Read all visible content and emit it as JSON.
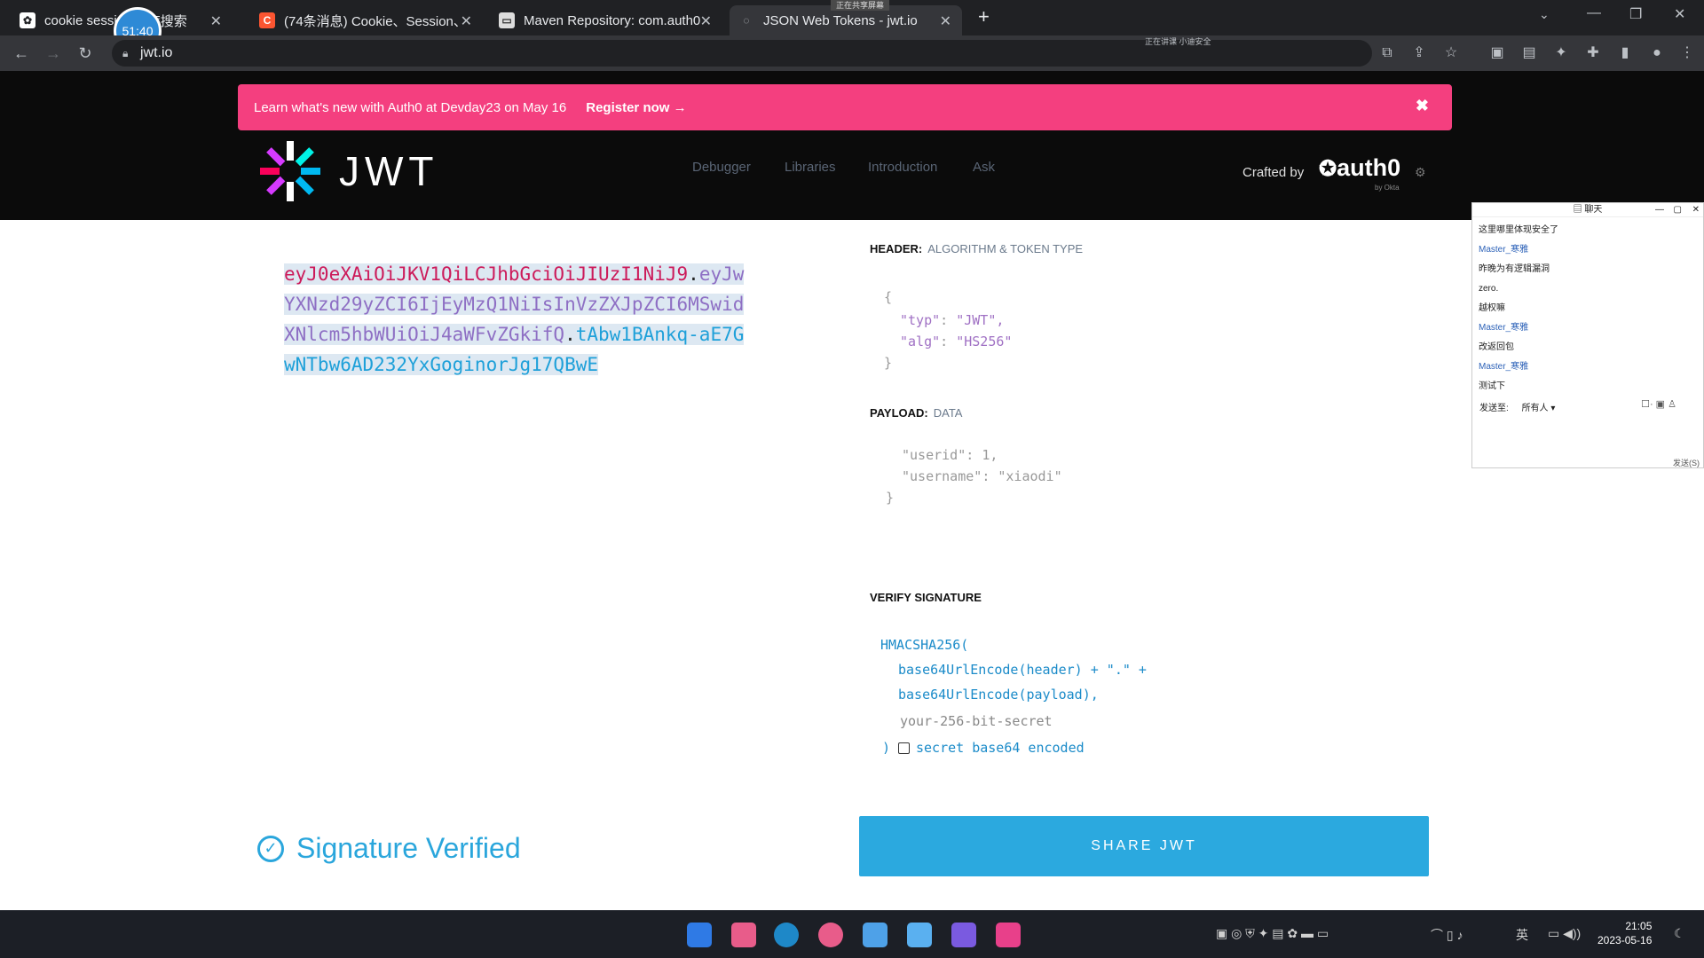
{
  "browser": {
    "tabs": [
      {
        "title": "cookie sessi",
        "extra": "度搜索"
      },
      {
        "title": "(74条消息) Cookie、Session、"
      },
      {
        "title": "Maven Repository: com.auth0"
      },
      {
        "title": "JSON Web Tokens - jwt.io"
      }
    ],
    "tab_badge": "正在共享屏幕",
    "url": "jwt.io",
    "share_status": "正在讲课 小迪安全"
  },
  "recording_timer": "51:40",
  "banner": {
    "text": "Learn what's new with Auth0 at Devday23 on May 16",
    "link": "Register now →",
    "close": "✖"
  },
  "site": {
    "logo_text": "JWT",
    "nav": [
      "Debugger",
      "Libraries",
      "Introduction",
      "Ask"
    ],
    "crafted_by": "Crafted by",
    "auth0": "auth0",
    "auth0_sub": "by Okta"
  },
  "encoded": {
    "header_part": "eyJ0eXAiOiJKV1QiLCJhbGciOiJIUzI1NiJ9",
    "payload_part": "eyJwYXNzd29yZCI6IjEyMzQ1NiIsInVzZXJpZCI6MSwidXNlcm5hbWUiOiJ4aWFvZGkifQ",
    "signature_part": "tAbw1BAnkq-aE7GwNTbw6AD232YxGoginorJg17QBwE"
  },
  "decoded": {
    "header_title": "HEADER:",
    "header_sub": "ALGORITHM & TOKEN TYPE",
    "header_lines": [
      {
        "key": "\"typ\"",
        "value": "\"JWT\","
      },
      {
        "key": "\"alg\"",
        "value": "\"HS256\""
      }
    ],
    "payload_title": "PAYLOAD:",
    "payload_sub": "DATA",
    "payload_lines": [
      {
        "key": "\"userid\"",
        "value": "1,"
      },
      {
        "key": "\"username\"",
        "value": "\"xiaodi\""
      }
    ],
    "verify_title": "VERIFY SIGNATURE",
    "verify_fn": "HMACSHA256(",
    "verify_line1": "base64UrlEncode(header) + \".\" +",
    "verify_line2": "base64UrlEncode(payload),",
    "secret_placeholder": "your-256-bit-secret",
    "secret_b64": "secret base64 encoded"
  },
  "signature_verified": "Signature Verified",
  "share_button": "SHARE JWT",
  "chat": {
    "title": "聊天",
    "messages": [
      {
        "text": "这里哪里体现安全了",
        "user": false
      },
      {
        "text": "Master_寒雅",
        "user": true
      },
      {
        "text": "昨晚为有逻辑漏洞",
        "user": false
      },
      {
        "text": "zero.",
        "user": false
      },
      {
        "text": "越权嘛",
        "user": false
      },
      {
        "text": "Master_寒雅",
        "user": true
      },
      {
        "text": "改返回包",
        "user": false
      },
      {
        "text": "Master_寒雅",
        "user": true
      },
      {
        "text": "测试下",
        "user": false
      }
    ],
    "send_to_label": "发送至:",
    "send_to_value": "所有人 ▾",
    "send_button": "发送(S)"
  },
  "taskbar": {
    "time": "21:05",
    "date": "2023-05-16",
    "ime": "英"
  },
  "colors": {
    "banner": "#f43f7f",
    "header_part": "#cc1a5a",
    "payload_part": "#8e6fc4",
    "signature_part": "#1ea0d9",
    "share_button": "#2ba9df"
  }
}
